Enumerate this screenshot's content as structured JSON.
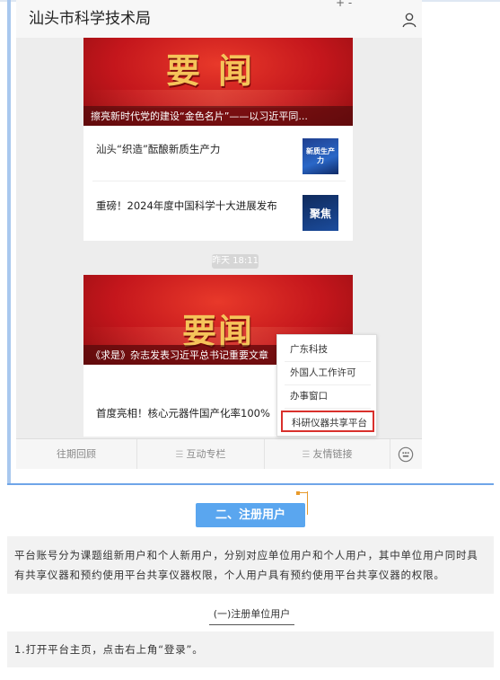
{
  "header": {
    "title": "汕头市科学技术局",
    "mini": "+    -"
  },
  "feed": {
    "card1": {
      "banner_text": "要闻",
      "banner_caption": "擦亮新时代党的建设“金色名片”——以习近平同...",
      "items": [
        {
          "text": "汕头“织造”酝酿新质生产力",
          "thumb_text": "新质生产力"
        },
        {
          "text": "重磅！2024年度中国科学十大进展发布",
          "thumb_text": "聚焦"
        }
      ]
    },
    "time": "昨天 18:11",
    "card2": {
      "banner_text": "要闻",
      "banner_caption": "《求是》杂志发表习近平总书记重要文章",
      "items": [
        {
          "text": "首度亮相！核心元器件国产化率100%"
        }
      ]
    }
  },
  "tabbar": {
    "tab1": "往期回顾",
    "tab2": "互动专栏",
    "tab3": "友情链接"
  },
  "popup": {
    "items": [
      "广东科技",
      "外国人工作许可",
      "办事窗口",
      "科研仪器共享平台"
    ]
  },
  "section": {
    "title": "二、注册用户"
  },
  "body": {
    "paragraph": "平台账号分为课题组新用户和个人新用户，分别对应单位用户和个人用户，其中单位用户同时具有共享仪器和预约使用平台共享仪器权限，个人用户具有预约使用平台共享仪器的权限。",
    "subtitle": "(一)注册单位用户",
    "step1": "1.打开平台主页，点击右上角“登录”。"
  },
  "colors": {
    "accent": "#5aa6ef",
    "banner_red": "#c4161c",
    "highlight_border": "#d9302c",
    "pin_orange": "#e89a2b"
  }
}
